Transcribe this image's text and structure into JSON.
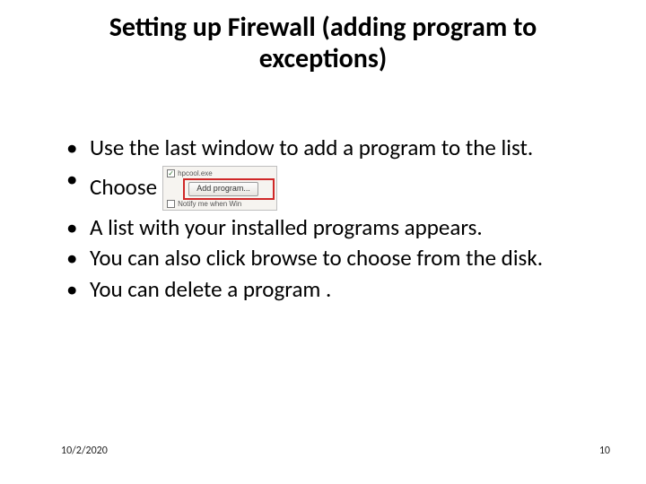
{
  "title_line1": "Setting up Firewall (adding program to",
  "title_line2": "exceptions)",
  "bullets": {
    "b1": "Use the last window to add a program to the list.",
    "b2": "Choose",
    "b3": "A list with your installed programs appears.",
    "b4": "You can also click browse to choose from the disk.",
    "b5": "You can delete a program ."
  },
  "embed": {
    "row1_check": "✓",
    "row1_label": "hpcool.exe",
    "button_label": "Add program...",
    "row3_label": "Notify me when Win"
  },
  "footer": {
    "date": "10/2/2020",
    "page": "10"
  }
}
